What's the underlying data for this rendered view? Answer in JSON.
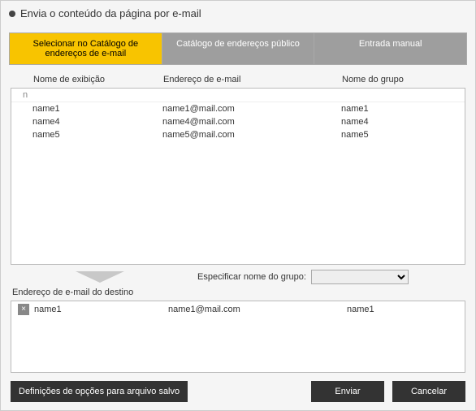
{
  "window": {
    "title": "Envia o conteúdo da página por e-mail"
  },
  "tabs": {
    "select_catalog": "Selecionar no Catálogo de endereços de e-mail",
    "public_catalog": "Catálogo de endereços público",
    "manual_entry": "Entrada manual"
  },
  "columns": {
    "display_name": "Nome de exibição",
    "email": "Endereço de e-mail",
    "group": "Nome do grupo"
  },
  "filter_text": "n",
  "contacts": [
    {
      "name": "name1",
      "email": "name1@mail.com",
      "group": "name1"
    },
    {
      "name": "name4",
      "email": "name4@mail.com",
      "group": "name4"
    },
    {
      "name": "name5",
      "email": "name5@mail.com",
      "group": "name5"
    }
  ],
  "group_spec": {
    "label": "Especificar nome do grupo:",
    "value": ""
  },
  "destination": {
    "label": "Endereço de e-mail do destino",
    "items": [
      {
        "name": "name1",
        "email": "name1@mail.com",
        "group": "name1"
      }
    ]
  },
  "buttons": {
    "saved_file_options": "Definições de opções para arquivo salvo",
    "send": "Enviar",
    "cancel": "Cancelar"
  },
  "icons": {
    "remove": "×"
  }
}
